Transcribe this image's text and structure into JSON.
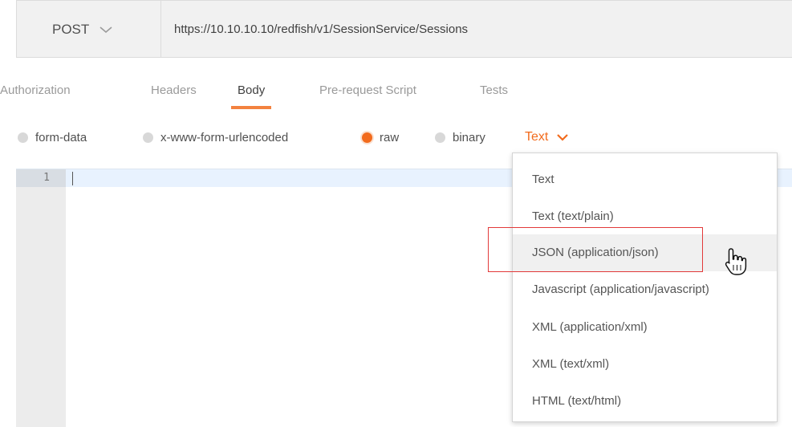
{
  "request": {
    "method": "POST",
    "url": "https://10.10.10.10/redfish/v1/SessionService/Sessions"
  },
  "tabs": [
    {
      "label": "Authorization"
    },
    {
      "label": "Headers"
    },
    {
      "label": "Body"
    },
    {
      "label": "Pre-request Script"
    },
    {
      "label": "Tests"
    }
  ],
  "active_tab": "Body",
  "body_types": [
    {
      "label": "form-data"
    },
    {
      "label": "x-www-form-urlencoded"
    },
    {
      "label": "raw"
    },
    {
      "label": "binary"
    }
  ],
  "selected_body_type": "raw",
  "raw_type": {
    "label": "Text"
  },
  "editor": {
    "line_number": "1"
  },
  "dropdown": {
    "items": [
      {
        "label": "Text"
      },
      {
        "label": "Text (text/plain)"
      },
      {
        "label": "JSON (application/json)"
      },
      {
        "label": "Javascript (application/javascript)"
      },
      {
        "label": "XML (application/xml)"
      },
      {
        "label": "XML (text/xml)"
      },
      {
        "label": "HTML (text/html)"
      }
    ],
    "hovered_item": "JSON (application/json)"
  },
  "colors": {
    "accent": "#f26b1d",
    "highlight_box": "#e23a3a"
  },
  "icons": [
    "chevron-down-icon",
    "chevron-down-icon",
    "pointer-hand-icon"
  ]
}
